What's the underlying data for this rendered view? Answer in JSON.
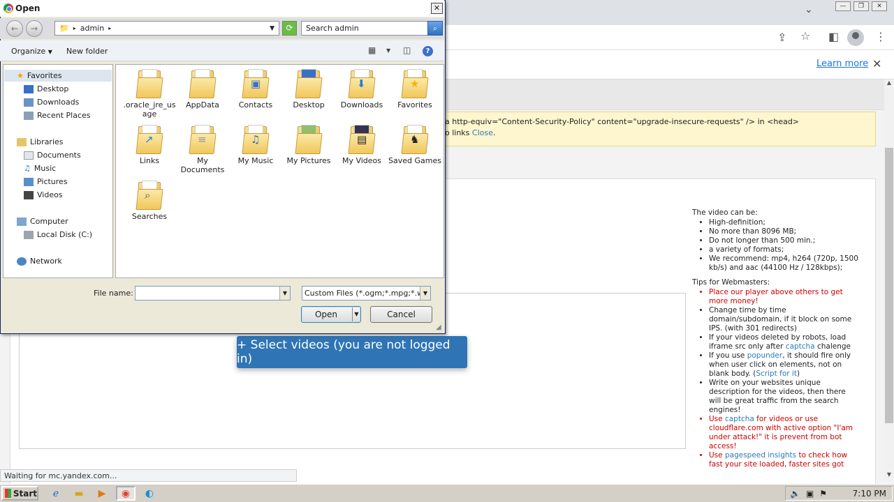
{
  "browser": {
    "learn_more": "Learn more",
    "status": "Waiting for mc.yandex.com..."
  },
  "page": {
    "warning_line1": "a http-equiv=\"Content-Security-Policy\" content=\"upgrade-insecure-requests\" /> in <head>",
    "warning_line2_pre": "o links ",
    "warning_close": "Close",
    "warning_line2_post": ".",
    "select_button": "+ Select videos (you are not logged in)",
    "video_heading": "The video can be:",
    "video_items": [
      "High-definition;",
      "No more than 8096 MB;",
      "Do not longer than 500 min.;",
      "a variety of formats;",
      "We recommend: mp4, h264 (720p, 1500 kb/s) and aac (44100 Hz / 128kbps);"
    ],
    "tips_heading": "Tips for Webmasters:",
    "tip1": "Place our player above others to get more money!",
    "tip2": "Change time by time domain/subdomain, if it block on some IPS. (with 301 redirects)",
    "tip3_pre": "If your videos deleted by robots, load iframe src only after ",
    "tip3_link": "captcha",
    "tip3_post": " chalenge",
    "tip4_pre": "If you use ",
    "tip4_link": "popunder",
    "tip4_mid": ", it should fire only when user click on elements, not on blank body. (",
    "tip4_link2": "Script for it",
    "tip4_post": ")",
    "tip5": "Write on your websites unique description for the videos, then there will be great traffic from the search engines!",
    "tip6_pre": "Use ",
    "tip6_link": "captcha",
    "tip6_post": " for videos or use cloudflare.com with active option \"I'am under attack!\" it is prevent from bot access!",
    "tip7_pre": "Use ",
    "tip7_link": "pagespeed insights",
    "tip7_post": " to check how fast your site loaded, faster sites got"
  },
  "dialog": {
    "title": "Open",
    "address": "admin",
    "search_placeholder": "Search admin",
    "organize": "Organize",
    "new_folder": "New folder",
    "nav": {
      "favorites": "Favorites",
      "desktop": "Desktop",
      "downloads": "Downloads",
      "recent": "Recent Places",
      "libraries": "Libraries",
      "documents": "Documents",
      "music": "Music",
      "pictures": "Pictures",
      "videos": "Videos",
      "computer": "Computer",
      "local_disk": "Local Disk (C:)",
      "network": "Network"
    },
    "folders": [
      {
        "label": ".oracle_jre_usage",
        "icon": "folder-icon"
      },
      {
        "label": "AppData",
        "icon": "folder-icon"
      },
      {
        "label": "Contacts",
        "icon": "contacts-folder-icon"
      },
      {
        "label": "Desktop",
        "icon": "desktop-folder-icon"
      },
      {
        "label": "Downloads",
        "icon": "downloads-folder-icon"
      },
      {
        "label": "Favorites",
        "icon": "favorites-folder-icon"
      },
      {
        "label": "Links",
        "icon": "links-folder-icon"
      },
      {
        "label": "My Documents",
        "icon": "documents-folder-icon"
      },
      {
        "label": "My Music",
        "icon": "music-folder-icon"
      },
      {
        "label": "My Pictures",
        "icon": "pictures-folder-icon"
      },
      {
        "label": "My Videos",
        "icon": "videos-folder-icon"
      },
      {
        "label": "Saved Games",
        "icon": "games-folder-icon"
      },
      {
        "label": "Searches",
        "icon": "searches-folder-icon"
      }
    ],
    "file_name_label": "File name:",
    "file_name_value": "",
    "filter": "Custom Files (*.ogm;*.mpg;*.w",
    "open_button": "Open",
    "cancel_button": "Cancel"
  },
  "taskbar": {
    "start": "Start",
    "clock": "7:10 PM"
  }
}
